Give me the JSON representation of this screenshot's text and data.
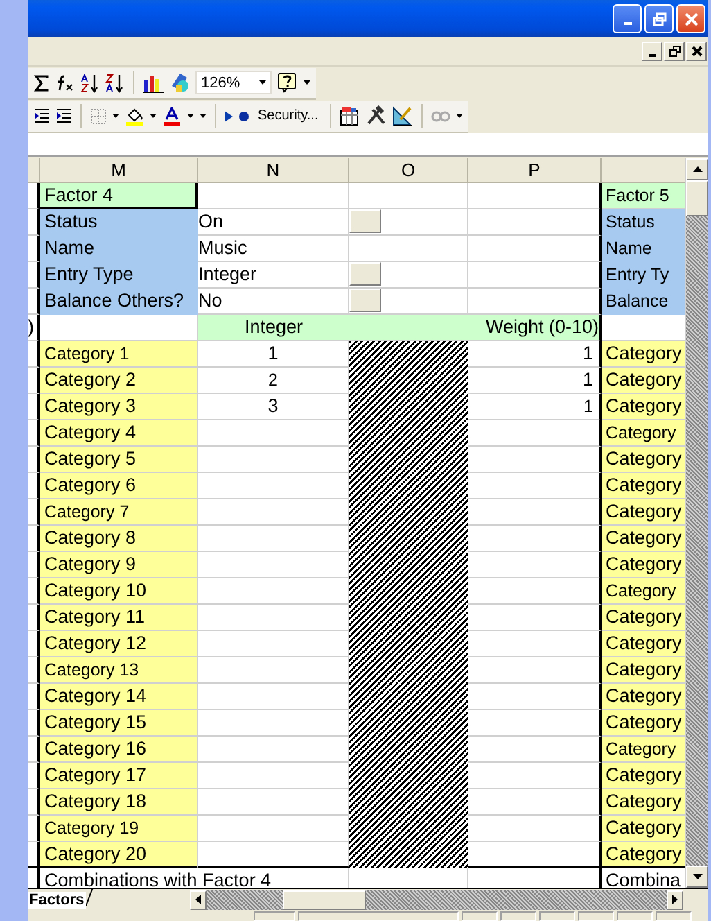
{
  "toolbar_standard": {
    "zoom": "126%"
  },
  "toolbar_vb": {
    "security": "Security..."
  },
  "columns": [
    "M",
    "N",
    "O",
    "P"
  ],
  "left_cut": ")",
  "factor": {
    "title": "Factor 4",
    "settings": [
      {
        "label": "Status",
        "value": "On",
        "has_button": true
      },
      {
        "label": "Name",
        "value": "Music",
        "has_button": false
      },
      {
        "label": "Entry Type",
        "value": "Integer",
        "has_button": true
      },
      {
        "label": "Balance Others?",
        "value": "No",
        "has_button": true
      }
    ]
  },
  "next_factor": {
    "title": "Factor 5",
    "settings": [
      "Status",
      "Name",
      "Entry Ty",
      "Balance"
    ]
  },
  "headers": {
    "integer": "Integer",
    "weight": "Weight (0-10)"
  },
  "categories": [
    {
      "label": "Category 1",
      "integer": "1",
      "weight": "1",
      "next": "Category"
    },
    {
      "label": "Category 2",
      "integer": "2",
      "weight": "1",
      "next": "Category"
    },
    {
      "label": "Category 3",
      "integer": "3",
      "weight": "1",
      "next": "Category"
    },
    {
      "label": "Category 4",
      "next": "Category"
    },
    {
      "label": "Category 5",
      "next": "Category"
    },
    {
      "label": "Category 6",
      "next": "Category"
    },
    {
      "label": "Category 7",
      "next": "Category"
    },
    {
      "label": "Category 8",
      "next": "Category"
    },
    {
      "label": "Category 9",
      "next": "Category"
    },
    {
      "label": "Category 10",
      "next": "Category"
    },
    {
      "label": "Category 11",
      "next": "Category"
    },
    {
      "label": "Category 12",
      "next": "Category"
    },
    {
      "label": "Category 13",
      "next": "Category"
    },
    {
      "label": "Category 14",
      "next": "Category"
    },
    {
      "label": "Category 15",
      "next": "Category"
    },
    {
      "label": "Category 16",
      "next": "Category"
    },
    {
      "label": "Category 17",
      "next": "Category"
    },
    {
      "label": "Category 18",
      "next": "Category"
    },
    {
      "label": "Category 19",
      "next": "Category"
    },
    {
      "label": "Category 20",
      "next": "Category"
    }
  ],
  "combinations": {
    "label": "Combinations with Factor 4",
    "next": "Combina"
  },
  "sheet_tabs": [
    {
      "label": "Factors",
      "selected": true
    }
  ]
}
